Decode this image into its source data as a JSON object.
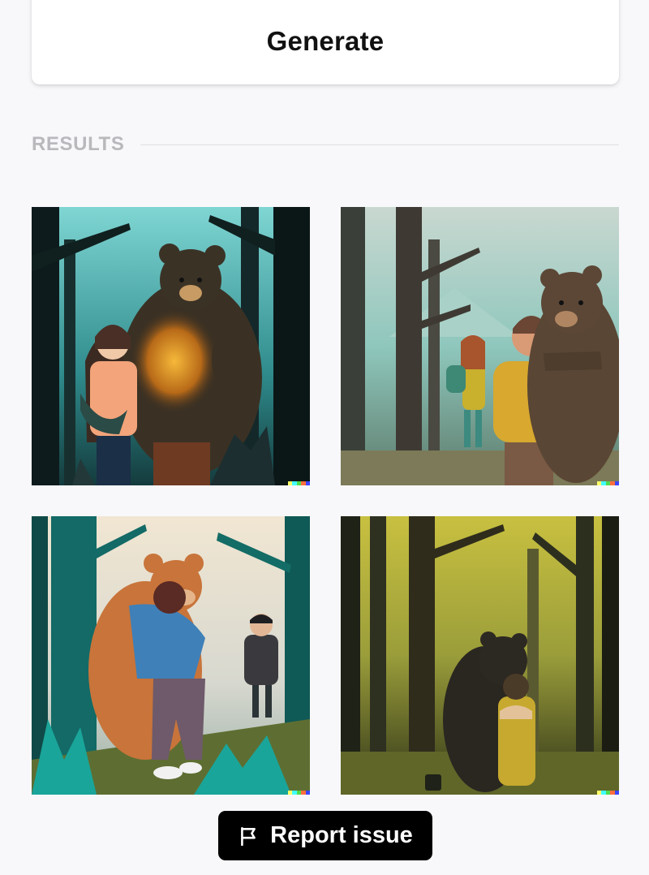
{
  "generate": {
    "label": "Generate"
  },
  "results": {
    "heading": "RESULTS"
  },
  "images": [
    {
      "subject": "bear in forest with girl holding face"
    },
    {
      "subject": "bear hugging man while girl walks in forest"
    },
    {
      "subject": "bear hugging woman while man watches"
    },
    {
      "subject": "dark bear hugging girl in yellow forest"
    }
  ],
  "signature_colors": [
    "#ffff66",
    "#42ffff",
    "#51da4c",
    "#ff6e3c",
    "#3c46ff"
  ],
  "report": {
    "label": "Report issue",
    "icon": "flag-icon"
  }
}
